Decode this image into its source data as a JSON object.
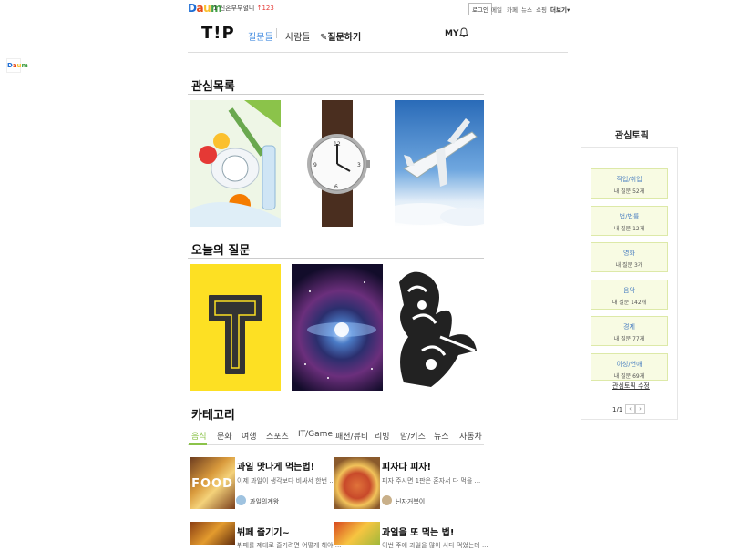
{
  "topbar": {
    "logo": "Daum",
    "rank_num": "1",
    "rank_text": "신혼부부혈니",
    "rank_change": "123",
    "login": "로그인",
    "links": [
      "메일",
      "카페",
      "뉴스",
      "쇼핑",
      "더보기"
    ]
  },
  "header": {
    "logo": "T!P",
    "nav_questions": "질문들",
    "nav_people": "사람들",
    "nav_ask": "질문하기",
    "my": "MY"
  },
  "sections": {
    "interest": "관심목록",
    "today": "오늘의 질문",
    "category": "카테고리"
  },
  "categories": [
    "음식",
    "문화",
    "여행",
    "스포츠",
    "IT/Game",
    "패션/뷰티",
    "리빙",
    "맘/키즈",
    "뉴스",
    "자동차"
  ],
  "cards": [
    {
      "title": "과일 맛나게 먹는법!",
      "desc": "이제 과일이 생각보다 비싸서 한번 ...",
      "user": "과일의계왕",
      "thumb_text": "FOOD"
    },
    {
      "title": "피자다 피자!",
      "desc": "피자 주시면 1판은 혼자서 다 먹을 ...",
      "user": "닌자거북이"
    },
    {
      "title": "뷔페 즐기기~",
      "desc": "뷔페를 제대로 즐기려면 어떻게 해야 ...",
      "user": ""
    },
    {
      "title": "과일을 또 먹는 법!",
      "desc": "이번 주에 과일을 많이 사다 먹었는데 ...",
      "user": ""
    }
  ],
  "topics": {
    "title": "관심토픽",
    "items": [
      {
        "name": "직업/취업",
        "count": "내 질문 52개"
      },
      {
        "name": "법/법률",
        "count": "내 질문 12개"
      },
      {
        "name": "영화",
        "count": "내 질문 3개"
      },
      {
        "name": "음악",
        "count": "내 질문 142개"
      },
      {
        "name": "경제",
        "count": "내 질문 77개"
      },
      {
        "name": "이성/연애",
        "count": "내 질문 69개"
      }
    ],
    "edit": "관심토픽 수정",
    "page": "1/1"
  }
}
